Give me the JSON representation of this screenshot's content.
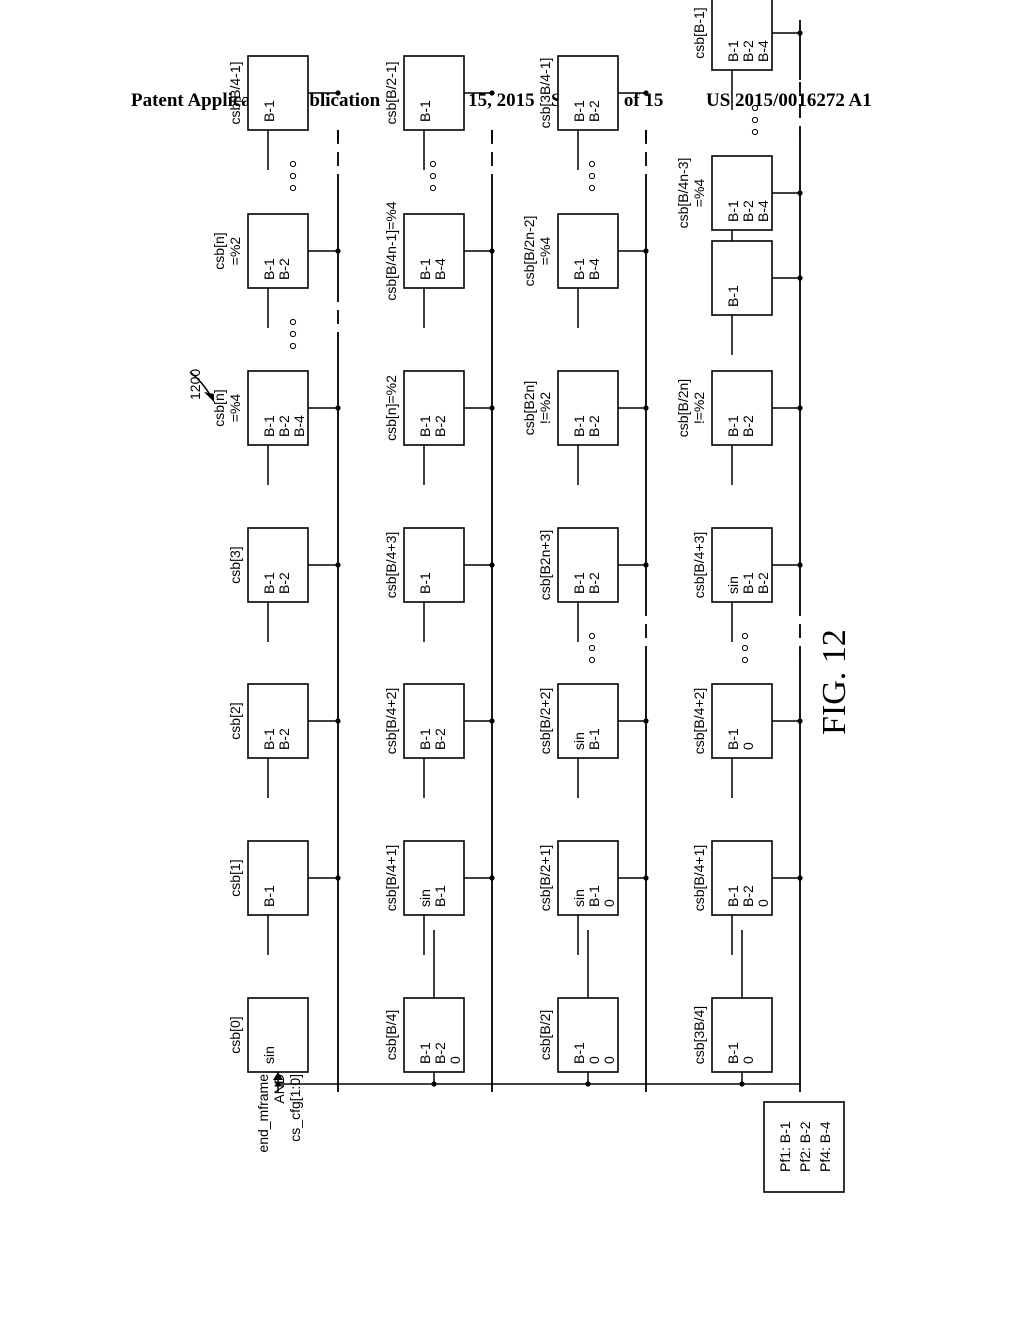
{
  "header": {
    "publication": "Patent Application Publication",
    "date": "Jan. 15, 2015",
    "sheet": "Sheet 14 of 15",
    "number": "US 2015/0016272 A1"
  },
  "figure": {
    "ref_number": "1200",
    "caption": "FIG. 12",
    "input_label": [
      "end_mframe",
      "AND",
      "cs_cfg[1:0]"
    ],
    "legend": [
      "Pf1: B-1",
      "Pf2: B-2",
      "Pf4: B-4"
    ],
    "ellipsis": "◦ ◦ ◦",
    "rows": [
      {
        "blocks": [
          {
            "label": [
              "csb[0]"
            ],
            "ports": [
              "sin"
            ]
          },
          {
            "label": [
              "csb[1]"
            ],
            "ports": [
              "B-1"
            ]
          },
          {
            "label": [
              "csb[2]"
            ],
            "ports": [
              "B-1",
              "B-2"
            ]
          },
          {
            "label": [
              "csb[3]"
            ],
            "ports": [
              "B-1",
              "B-2"
            ]
          },
          {
            "label": [
              "csb[n]",
              "=%4"
            ],
            "ports": [
              "B-1",
              "B-2",
              "B-4"
            ]
          },
          {
            "label": [
              "csb[n]",
              "=%2"
            ],
            "ports": [
              "B-1",
              "B-2"
            ]
          },
          {
            "label": [
              "csb[B/4-1]"
            ],
            "ports": [
              "B-1"
            ]
          }
        ]
      },
      {
        "blocks": [
          {
            "label": [
              "csb[B/4]"
            ],
            "ports": [
              "B-1",
              "B-2",
              "0"
            ]
          },
          {
            "label": [
              "csb[B/4+1]"
            ],
            "ports": [
              "sin",
              "B-1"
            ]
          },
          {
            "label": [
              "csb[B/4+2]"
            ],
            "ports": [
              "B-1",
              "B-2"
            ]
          },
          {
            "label": [
              "csb[B/4+3]"
            ],
            "ports": [
              "B-1"
            ]
          },
          {
            "label": [
              "csb[n]=%2"
            ],
            "ports": [
              "B-1",
              "B-2"
            ]
          },
          {
            "label": [
              "csb[B/4n-1]=%4"
            ],
            "ports": [
              "B-1",
              "B-4"
            ]
          },
          {
            "label": [
              "csb[B/2-1]"
            ],
            "ports": [
              "B-1"
            ]
          }
        ]
      },
      {
        "blocks": [
          {
            "label": [
              "csb[B/2]"
            ],
            "ports": [
              "B-1",
              "0",
              "0"
            ]
          },
          {
            "label": [
              "csb[B/2+1]"
            ],
            "ports": [
              "sin",
              "B-1",
              "0"
            ]
          },
          {
            "label": [
              "csb[B/2+2]"
            ],
            "ports": [
              "sin",
              "B-1"
            ]
          },
          {
            "label": [
              "csb[B2n+3]"
            ],
            "ports": [
              "B-1",
              "B-2"
            ]
          },
          {
            "label": [
              "csb[B2n]",
              "!=%2"
            ],
            "ports": [
              "B-1",
              "B-2"
            ]
          },
          {
            "label": [
              "csb[B/2n-2]",
              "=%4"
            ],
            "ports": [
              "B-1",
              "B-4"
            ]
          },
          {
            "label": [
              "csb[3B/4-1]"
            ],
            "ports": [
              "B-1",
              "B-2"
            ]
          }
        ]
      },
      {
        "blocks": [
          {
            "label": [
              "csb[3B/4]"
            ],
            "ports": [
              "B-1",
              "0"
            ]
          },
          {
            "label": [
              "csb[B/4+1]"
            ],
            "ports": [
              "B-1",
              "B-2",
              "0"
            ]
          },
          {
            "label": [
              "csb[B/4+2]"
            ],
            "ports": [
              "B-1",
              "0"
            ]
          },
          {
            "label": [
              "csb[B/4+3]"
            ],
            "ports": [
              "sin",
              "B-1",
              "B-2"
            ]
          },
          {
            "label": [
              "csb[B/2n]",
              "!=%2"
            ],
            "ports": [
              "B-1",
              "B-2"
            ]
          },
          {
            "label": [],
            "ports": [
              "B-1"
            ]
          },
          {
            "label": [
              "csb[B/4n-3]",
              "=%4"
            ],
            "ports": [
              "B-1",
              "B-2",
              "B-4"
            ]
          },
          {
            "label": [
              "csb[B-1]"
            ],
            "ports": [
              "B-1",
              "B-2",
              "B-4"
            ]
          }
        ]
      }
    ]
  }
}
